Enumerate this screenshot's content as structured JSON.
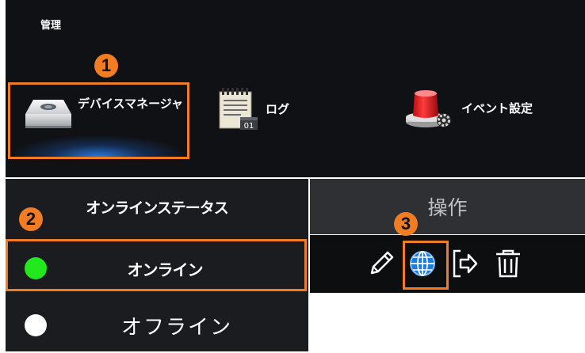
{
  "header": {
    "title": "管理"
  },
  "tiles": [
    {
      "label": "デバイスマネージャ",
      "icon": "device-manager-icon"
    },
    {
      "label": "ログ",
      "icon": "log-calendar-icon"
    },
    {
      "label": "イベント設定",
      "icon": "alarm-light-icon"
    }
  ],
  "status_panel": {
    "header": "オンラインステータス",
    "options": [
      {
        "label": "オンライン",
        "color": "#22e81e",
        "selected": true
      },
      {
        "label": "オフライン",
        "color": "#ffffff",
        "selected": false
      }
    ]
  },
  "operations": {
    "header": "操作",
    "actions": [
      {
        "icon": "pencil-icon",
        "name": "edit"
      },
      {
        "icon": "globe-icon",
        "name": "web"
      },
      {
        "icon": "logout-icon",
        "name": "logout"
      },
      {
        "icon": "trash-icon",
        "name": "delete"
      }
    ]
  },
  "annotations": [
    "1",
    "2",
    "3"
  ],
  "colors": {
    "highlight": "#f07d23",
    "panel_bg": "#101114"
  }
}
